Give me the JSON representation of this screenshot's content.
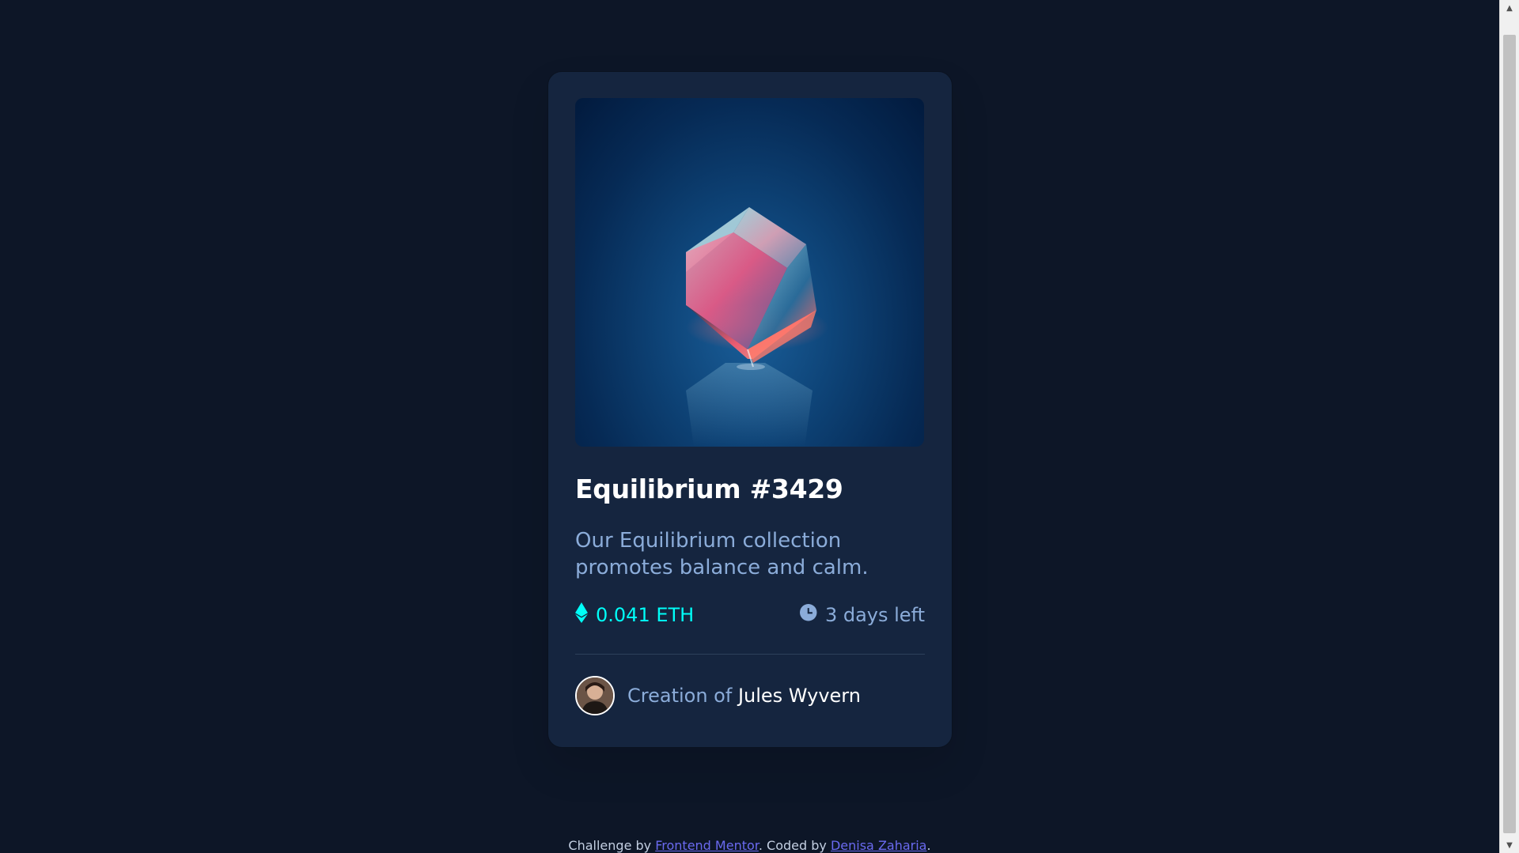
{
  "card": {
    "title": "Equilibrium #3429",
    "description": "Our Equilibrium collection promotes balance and calm.",
    "price": "0.041 ETH",
    "time_left": "3 days left",
    "creator_prefix": "Creation of",
    "creator_name": "Jules Wyvern",
    "image_alt": "Equilibrium cube"
  },
  "footer": {
    "challenge_prefix": "Challenge by",
    "challenge_link": "Frontend Mentor",
    "coded_prefix": ". Coded by",
    "coded_link": "Denisa Zaharia",
    "suffix": "."
  },
  "icons": {
    "price": "ethereum-icon",
    "time": "clock-icon",
    "scroll_up": "chevron-up-icon",
    "scroll_down": "chevron-down-icon"
  },
  "colors": {
    "page_background": "#0d1627",
    "card_background": "#15253f",
    "accent_cyan": "#00fff8",
    "soft_blue": "#8bacd9",
    "white": "#ffffff",
    "link": "#6a6af0"
  }
}
